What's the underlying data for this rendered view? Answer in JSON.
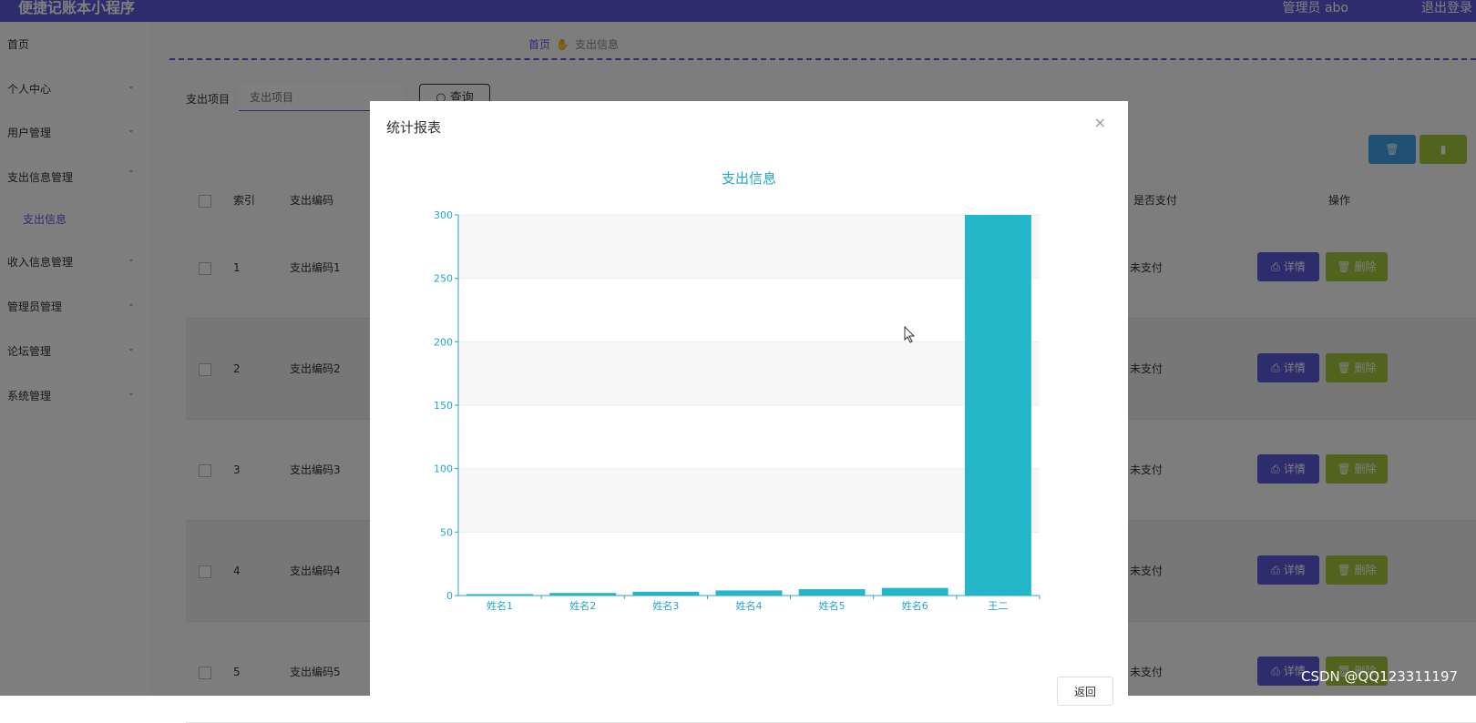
{
  "app": {
    "title": "便捷记账本小程序",
    "user": "管理员 abo",
    "logout": "退出登录"
  },
  "sidebar": {
    "items": [
      {
        "label": "首页",
        "top": 16,
        "chev": ""
      },
      {
        "label": "个人中心",
        "top": 65,
        "chev": "⌄"
      },
      {
        "label": "用户管理",
        "top": 113,
        "chev": "⌄"
      },
      {
        "label": "支出信息管理",
        "top": 162,
        "chev": "⌃"
      },
      {
        "label": "收入信息管理",
        "top": 255,
        "chev": "⌄"
      },
      {
        "label": "管理员管理",
        "top": 304,
        "chev": "⌄"
      },
      {
        "label": "论坛管理",
        "top": 353,
        "chev": "⌄"
      },
      {
        "label": "系统管理",
        "top": 402,
        "chev": "⌄"
      }
    ],
    "sub_item": "支出信息"
  },
  "breadcrumb": {
    "home": "首页",
    "sep": "✋",
    "current": "支出信息"
  },
  "search": {
    "label": "支出项目",
    "placeholder": "支出项目",
    "button": "○ 查询"
  },
  "table": {
    "headers": {
      "index": "索引",
      "code": "支出编码",
      "paid": "是否支付",
      "ops": "操作"
    },
    "rows": [
      {
        "index": "1",
        "code": "支出编码1",
        "paid": "未支付"
      },
      {
        "index": "2",
        "code": "支出编码2",
        "paid": "未支付"
      },
      {
        "index": "3",
        "code": "支出编码3",
        "paid": "未支付"
      },
      {
        "index": "4",
        "code": "支出编码4",
        "paid": "未支付"
      },
      {
        "index": "5",
        "code": "支出编码5",
        "paid": "未支付"
      }
    ],
    "detail_label": "⎙ 详情",
    "delete_label": "🗑 删除"
  },
  "modal": {
    "title": "统计报表",
    "close": "×",
    "return_label": "返回"
  },
  "chart_data": {
    "type": "bar",
    "title": "支出信息",
    "categories": [
      "姓名1",
      "姓名2",
      "姓名3",
      "姓名4",
      "姓名5",
      "姓名6",
      "王二"
    ],
    "values": [
      1,
      2,
      3,
      4,
      5,
      6,
      300
    ],
    "yticks": [
      "0",
      "50",
      "100",
      "150",
      "200",
      "250",
      "300"
    ],
    "ylim": [
      0,
      300
    ],
    "color": "#23b7ca"
  },
  "watermark": "CSDN @QQ123311197"
}
